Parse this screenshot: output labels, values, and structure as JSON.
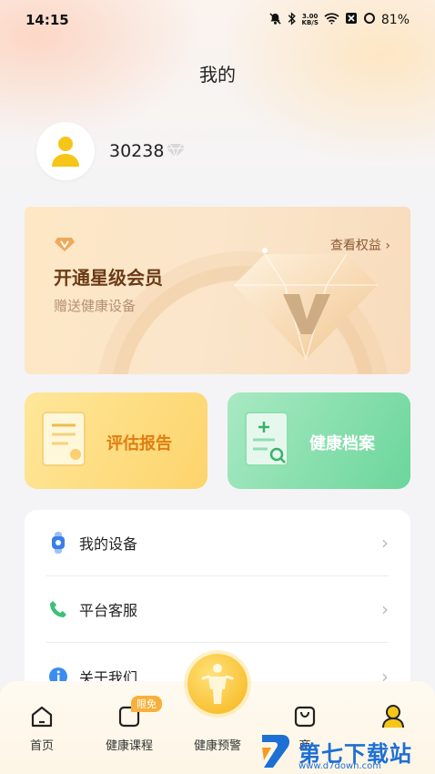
{
  "status_bar": {
    "time": "14:15",
    "speed_value": "3.00",
    "speed_unit": "KB/S",
    "battery": "81%"
  },
  "page": {
    "title": "我的"
  },
  "profile": {
    "user_id": "30238"
  },
  "vip": {
    "title": "开通星级会员",
    "subtitle": "赠送健康设备",
    "link": "查看权益",
    "accent": "#6b3b17"
  },
  "quick_cards": [
    {
      "label": "评估报告",
      "color": "#e07e13"
    },
    {
      "label": "健康档案",
      "color": "#ffffff"
    }
  ],
  "menu": [
    {
      "label": "我的设备",
      "icon": "watch-icon"
    },
    {
      "label": "平台客服",
      "icon": "phone-icon"
    },
    {
      "label": "关于我们",
      "icon": "info-icon"
    }
  ],
  "tab_bar": {
    "tabs": [
      {
        "label": "首页",
        "icon": "home-icon"
      },
      {
        "label": "健康课程",
        "icon": "course-icon"
      },
      {
        "label": "健康预警",
        "icon": "body-icon"
      },
      {
        "label": "商",
        "icon": "shop-icon"
      },
      {
        "label": "",
        "icon": "profile-icon"
      }
    ],
    "badge": "限免"
  },
  "watermark": {
    "text": "第七下载站",
    "url": "www.d7down.com"
  }
}
